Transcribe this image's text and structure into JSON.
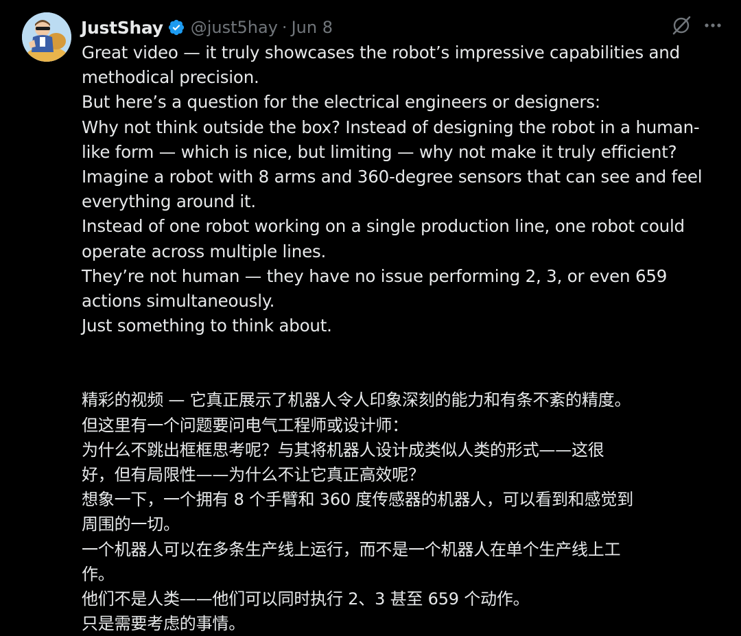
{
  "tweet": {
    "author": {
      "display_name": "JustShay",
      "handle": "@just5hay",
      "verified": true,
      "avatar_icon": "avatar-illustration-icon"
    },
    "separator": "·",
    "date": "Jun 8",
    "actions": {
      "grok_icon": "grok-icon",
      "more_icon": "more-dots-icon"
    },
    "english_lines": [
      "Great video — it truly showcases the robot’s impressive capabilities and",
      "methodical precision.",
      "But here’s a question for the electrical engineers or designers:",
      "Why not think outside the box? Instead of designing the robot in a human-",
      "like form — which is nice, but limiting — why not make it truly efficient?",
      "Imagine a robot with 8 arms and 360-degree sensors that can see and feel",
      "everything around it.",
      "Instead of one robot working on a single production line, one robot could",
      "operate across multiple lines.",
      "They’re not human — they have no issue performing 2, 3, or even 659",
      "actions simultaneously.",
      "Just something to think about."
    ],
    "chinese_lines": [
      "精彩的视频 — 它真正展示了机器人令人印象深刻的能力和有条不紊的精度。",
      "但这里有一个问题要问电气工程师或设计师：",
      "为什么不跳出框框思考呢？与其将机器人设计成类似人类的形式——这很",
      "好，但有局限性——为什么不让它真正高效呢？",
      "想象一下，一个拥有 8 个手臂和 360 度传感器的机器人，可以看到和感觉到",
      "周围的一切。",
      "一个机器人可以在多条生产线上运行，而不是一个机器人在单个生产线上工",
      "作。",
      "他们不是人类——他们可以同时执行 2、3 甚至 659 个动作。",
      "只是需要考虑的事情。"
    ]
  },
  "colors": {
    "background": "#000000",
    "text_primary": "#e7e9ea",
    "text_secondary": "#71767b",
    "verified_badge": "#1d9bf0"
  }
}
